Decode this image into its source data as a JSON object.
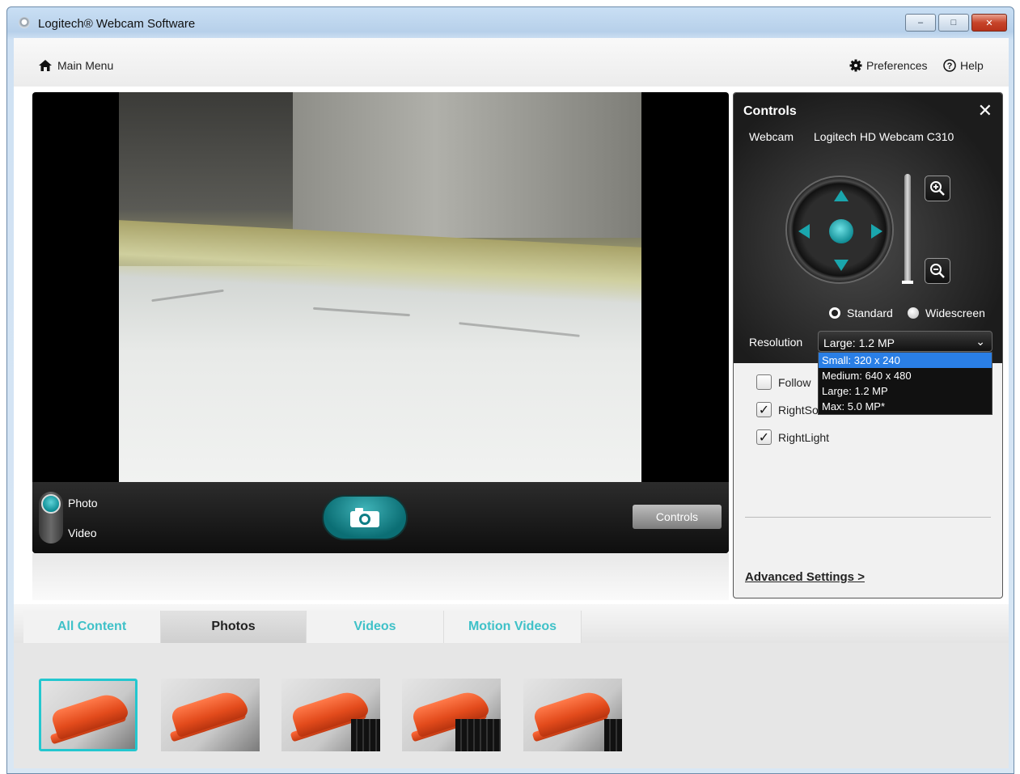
{
  "window": {
    "title": "Logitech® Webcam Software",
    "buttons": {
      "minimize": "–",
      "maximize": "□",
      "close": "✕"
    }
  },
  "topbar": {
    "main_menu": "Main Menu",
    "preferences": "Preferences",
    "help": "Help"
  },
  "capture": {
    "mode_photo": "Photo",
    "mode_video": "Video",
    "selected_mode": "Photo",
    "controls_button": "Controls"
  },
  "controls_panel": {
    "title": "Controls",
    "webcam_label": "Webcam",
    "webcam_name": "Logitech HD Webcam C310",
    "aspect_options": [
      {
        "label": "Standard",
        "selected": true
      },
      {
        "label": "Widescreen",
        "selected": false
      }
    ],
    "resolution_label": "Resolution",
    "resolution_value": "Large: 1.2 MP",
    "resolution_options": [
      {
        "label": "Small: 320 x 240",
        "highlighted": true
      },
      {
        "label": "Medium: 640 x 480",
        "highlighted": false
      },
      {
        "label": "Large: 1.2 MP",
        "highlighted": false
      },
      {
        "label": "Max: 5.0 MP*",
        "highlighted": false
      }
    ],
    "checkboxes": [
      {
        "label": "Follow",
        "checked": false
      },
      {
        "label": "RightSo",
        "checked": true
      },
      {
        "label": "RightLight",
        "checked": true
      }
    ],
    "advanced_link": "Advanced Settings >"
  },
  "tabs": [
    {
      "label": "All Content",
      "active": false
    },
    {
      "label": "Photos",
      "active": true
    },
    {
      "label": "Videos",
      "active": false
    },
    {
      "label": "Motion Videos",
      "active": false
    }
  ],
  "gallery": {
    "thumbnail_count": 5,
    "selected_index": 0
  },
  "colors": {
    "accent_teal": "#3fc1c8",
    "selection_blue": "#2a7fe6",
    "close_red": "#c7442a"
  }
}
